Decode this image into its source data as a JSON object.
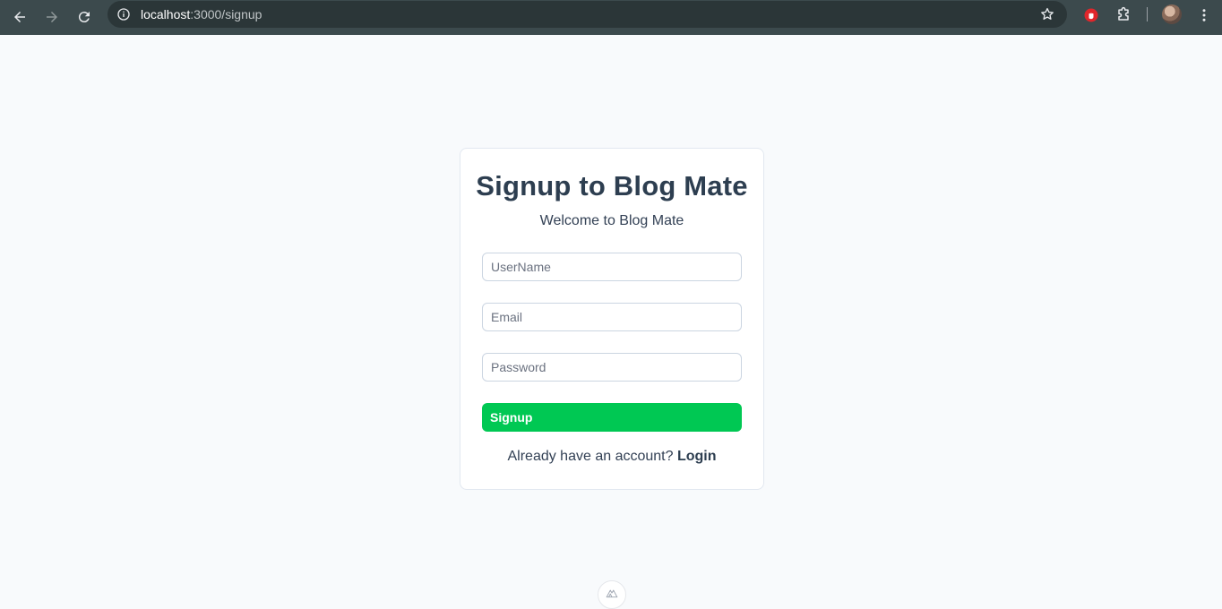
{
  "browser": {
    "url_host": "localhost",
    "url_path": ":3000/signup",
    "icons": [
      "back-arrow-icon",
      "forward-arrow-icon",
      "reload-icon",
      "site-info-icon",
      "star-icon",
      "extension-red-icon",
      "puzzle-icon",
      "menu-dots-icon"
    ]
  },
  "card": {
    "title": "Signup to Blog Mate",
    "subtitle": "Welcome to Blog Mate",
    "username_placeholder": "UserName",
    "email_placeholder": "Email",
    "password_placeholder": "Password",
    "signup_label": "Signup",
    "footer_prompt": "Already have an account? ",
    "login_label": "Login"
  },
  "colors": {
    "accent": "#00c853",
    "heading": "#2d3e50",
    "background": "#f8fafc"
  }
}
